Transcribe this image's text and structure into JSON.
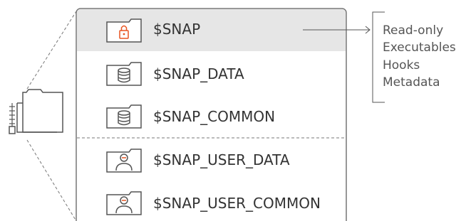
{
  "colors": {
    "border": "#777777",
    "highlight_row": "#e6e6e6",
    "text": "#333333",
    "accent_orange": "#e95420",
    "line": "#555555"
  },
  "rows": [
    {
      "label": "$SNAP",
      "icon": "lock-folder-icon",
      "highlighted": true
    },
    {
      "label": "$SNAP_DATA",
      "icon": "database-folder-icon",
      "highlighted": false
    },
    {
      "label": "$SNAP_COMMON",
      "icon": "database-folder-icon",
      "highlighted": false
    },
    {
      "label": "$SNAP_USER_DATA",
      "icon": "user-folder-icon",
      "highlighted": false
    },
    {
      "label": "$SNAP_USER_COMMON",
      "icon": "user-folder-icon",
      "highlighted": false
    }
  ],
  "snap_notes": [
    "Read-only",
    "Executables",
    "Hooks",
    "Metadata"
  ],
  "source_icon": "zipped-folder-icon"
}
